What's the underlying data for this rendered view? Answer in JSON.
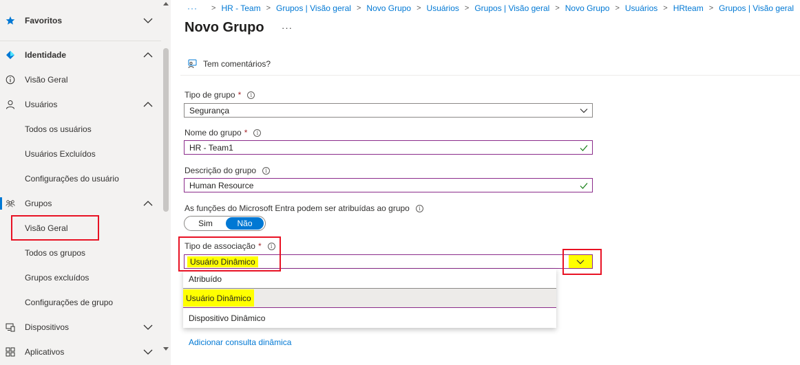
{
  "sidebar": {
    "items": [
      {
        "label": "Favoritos",
        "icon": "star-icon"
      },
      {
        "label": "Identidade",
        "icon": "identity-diamond-icon"
      },
      {
        "label": "Visão Geral",
        "icon": "info-icon"
      },
      {
        "label": "Usuários",
        "icon": "user-icon"
      },
      {
        "label": "Todos os usuários"
      },
      {
        "label": "Usuários Excluídos"
      },
      {
        "label": "Configurações do usuário"
      },
      {
        "label": "Grupos",
        "icon": "groups-icon"
      },
      {
        "label": "Visão Geral"
      },
      {
        "label": "Todos os grupos"
      },
      {
        "label": "Grupos excluídos"
      },
      {
        "label": "Configurações de grupo"
      },
      {
        "label": "Dispositivos",
        "icon": "devices-icon"
      },
      {
        "label": "Aplicativos",
        "icon": "apps-icon"
      }
    ]
  },
  "breadcrumb": {
    "ellipsis": "···",
    "items": [
      "HR - Team",
      "Grupos | Visão geral",
      "Novo Grupo",
      "Usuários",
      "Grupos | Visão geral",
      "Novo Grupo",
      "Usuários",
      "HRteam",
      "Grupos | Visão geral"
    ]
  },
  "page": {
    "title": "Novo Grupo",
    "more": "···",
    "feedback": "Tem comentários?"
  },
  "form": {
    "group_type": {
      "label": "Tipo de grupo",
      "required": "*",
      "value": "Segurança"
    },
    "group_name": {
      "label": "Nome do grupo",
      "required": "*",
      "value": "HR - Team1"
    },
    "group_description": {
      "label": "Descrição do grupo",
      "value": "Human Resource"
    },
    "entra_roles": {
      "label": "As funções do Microsoft Entra podem ser atribuídas ao grupo",
      "options": [
        "Sim",
        "Não"
      ],
      "selected": "Não"
    },
    "membership_type": {
      "label": "Tipo de associação",
      "required": "*",
      "value": "Usuário Dinâmico",
      "options": [
        "Atribuído",
        "Usuário Dinâmico",
        "Dispositivo Dinâmico"
      ]
    },
    "add_query_link": "Adicionar consulta dinâmica"
  },
  "colors": {
    "accent": "#0078d4",
    "highlight": "#ffff00",
    "annotation": "#e81123",
    "valid_border": "#8a2a8a",
    "check": "#107c10"
  }
}
